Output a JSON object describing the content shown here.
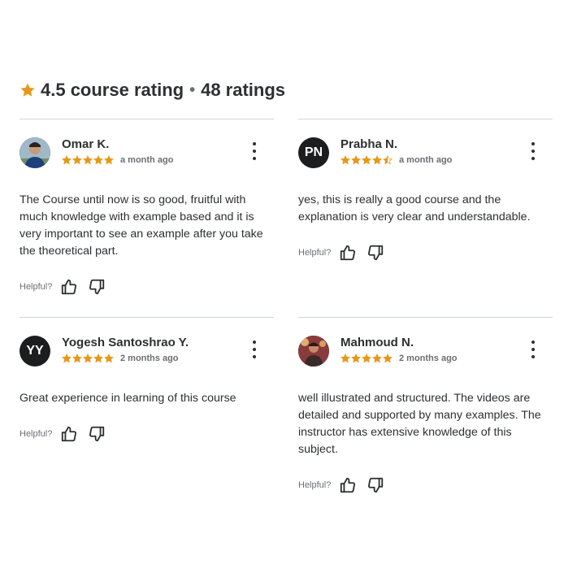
{
  "summary": {
    "rating_text": "4.5 course rating",
    "separator": "•",
    "ratings_count": "48 ratings",
    "star_color": "#e59819"
  },
  "reviews": [
    {
      "name": "Omar K.",
      "initials": "",
      "avatar_type": "photo",
      "rating": 5,
      "time": "a month ago",
      "text": "The Course until now is so good, fruitful with much knowledge with example based and it is very important to see an example after you take the theoretical part.",
      "helpful_label": "Helpful?"
    },
    {
      "name": "Prabha N.",
      "initials": "PN",
      "avatar_type": "initials",
      "rating": 4.5,
      "time": "a month ago",
      "text": "yes, this is really a good course and the explanation is very clear and understandable.",
      "helpful_label": "Helpful?"
    },
    {
      "name": "Yogesh Santoshrao Y.",
      "initials": "YY",
      "avatar_type": "initials",
      "rating": 5,
      "time": "2 months ago",
      "text": "Great experience in learning of this course",
      "helpful_label": "Helpful?"
    },
    {
      "name": "Mahmoud N.",
      "initials": "",
      "avatar_type": "photo",
      "rating": 5,
      "time": "2 months ago",
      "text": "well illustrated and structured. The videos are detailed and supported by many examples. The instructor has extensive knowledge of this subject.",
      "helpful_label": "Helpful?"
    }
  ]
}
